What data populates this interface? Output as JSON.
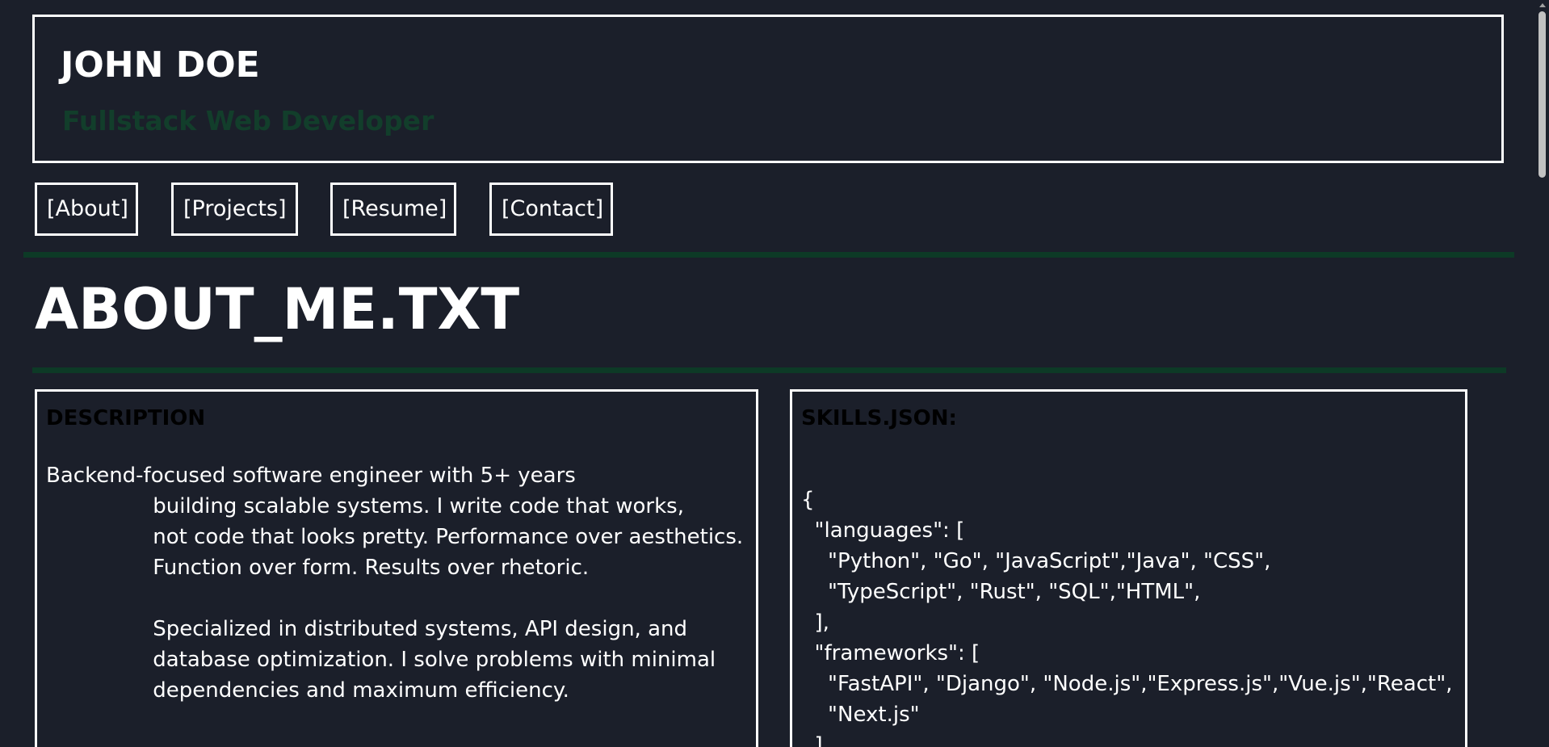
{
  "header": {
    "name": "JOHN DOE",
    "subtitle": "Fullstack Web Developer"
  },
  "nav": {
    "items": [
      {
        "label": "[About]"
      },
      {
        "label": "[Projects]"
      },
      {
        "label": "[Resume]"
      },
      {
        "label": "[Contact]"
      }
    ]
  },
  "main": {
    "heading": "ABOUT_ME.TXT",
    "description": {
      "title": "DESCRIPTION",
      "text": "Backend-focused software engineer with 5+ years\n                building scalable systems. I write code that works,\n                not code that looks pretty. Performance over aesthetics.\n                Function over form. Results over rhetoric.\n\n                Specialized in distributed systems, API design, and\n                database optimization. I solve problems with minimal\n                dependencies and maximum efficiency."
    },
    "skills": {
      "title": "SKILLS.JSON:",
      "code": "{\n  \"languages\": [\n    \"Python\", \"Go\", \"JavaScript\",\"Java\", \"CSS\",\n    \"TypeScript\", \"Rust\", \"SQL\",\"HTML\",\n  ],\n  \"frameworks\": [\n    \"FastAPI\", \"Django\", \"Node.js\",\"Express.js\",\"Vue.js\",\"React\",\n    \"Next.js\"\n  ],"
    }
  },
  "colors": {
    "background": "#1b1f2a",
    "foreground": "#ffffff",
    "accent_green": "#0d3a26",
    "subtitle_green": "#123e2b"
  }
}
